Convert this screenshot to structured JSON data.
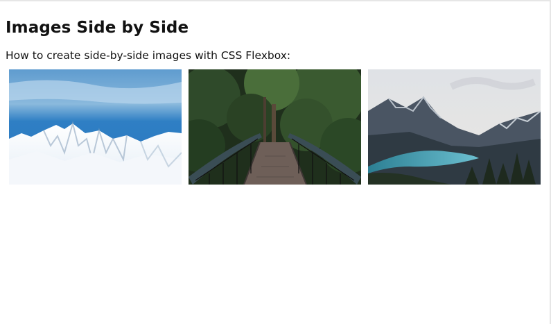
{
  "page": {
    "title": "Images Side by Side",
    "description": "How to create side-by-side images with CSS Flexbox:"
  },
  "images": [
    {
      "subject": "snowy mountains",
      "icon": "mountain-snow-image"
    },
    {
      "subject": "forest bridge",
      "icon": "forest-bridge-image"
    },
    {
      "subject": "mountain lake",
      "icon": "mountain-lake-image"
    }
  ],
  "colors": {
    "sky_blue": "#4a8fd0",
    "forest_green": "#2f4a2a",
    "lake_teal": "#3c8fa0"
  }
}
